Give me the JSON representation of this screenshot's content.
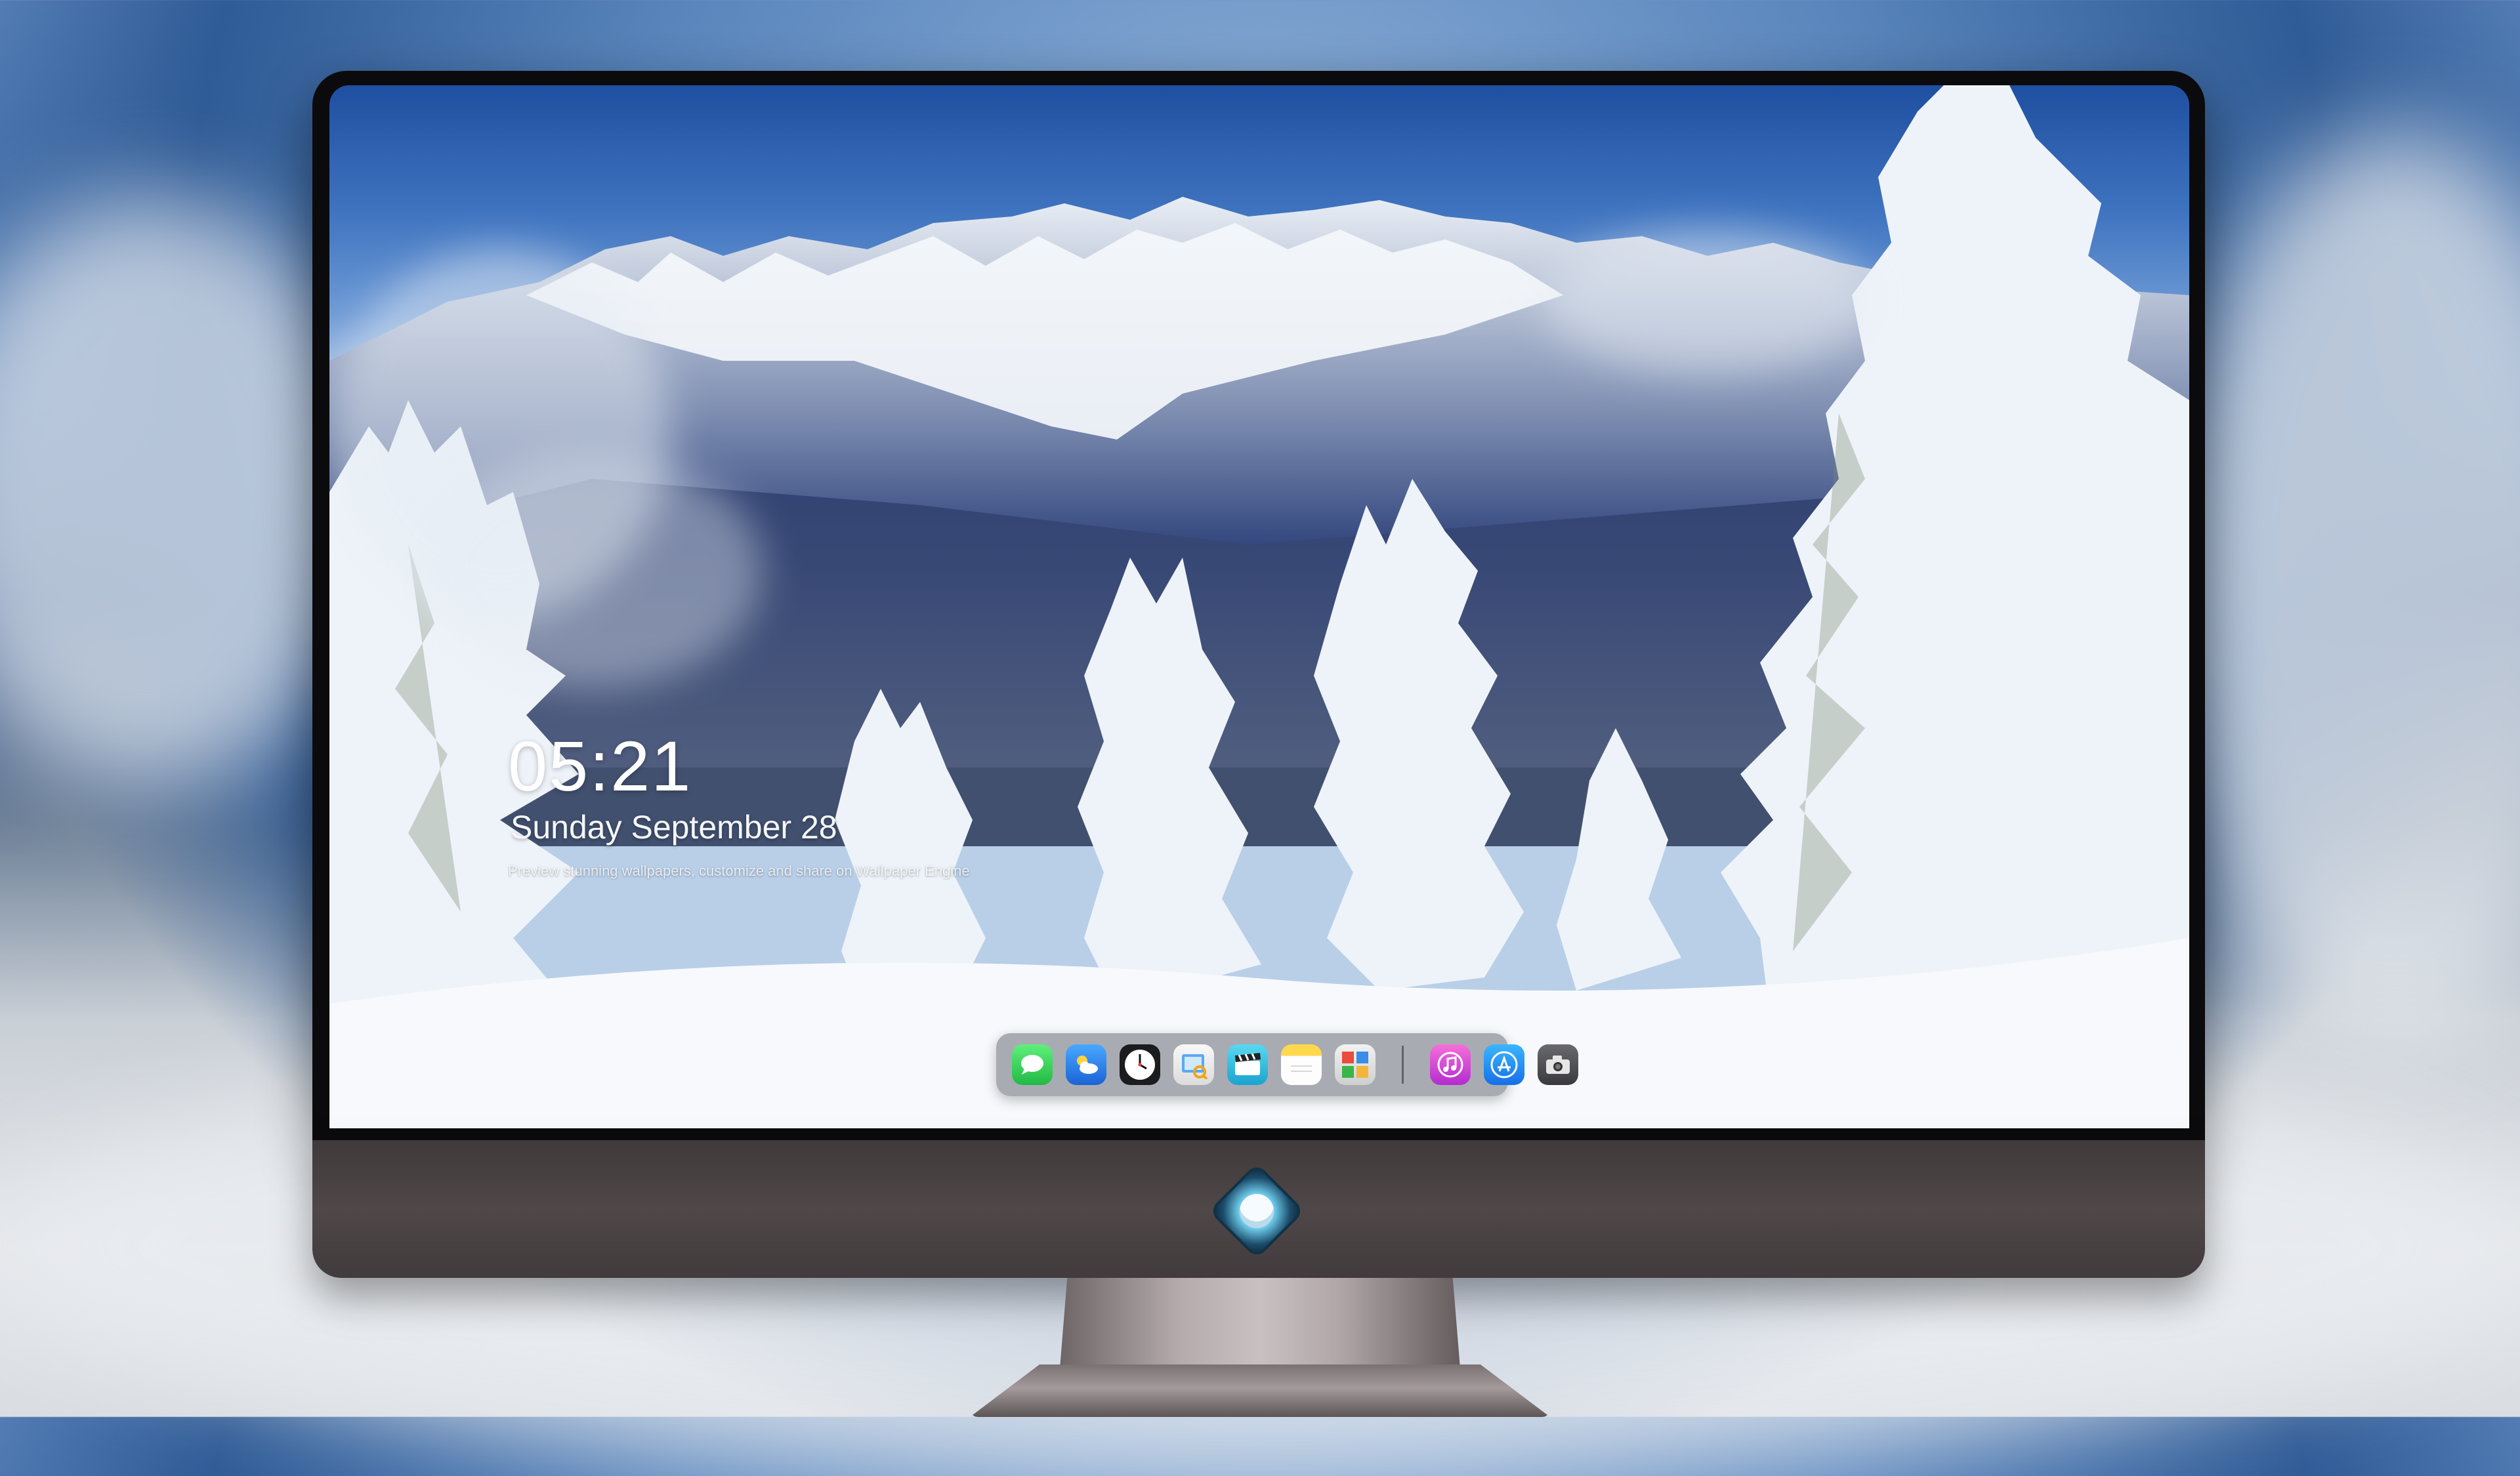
{
  "lockscreen": {
    "time": "05:21",
    "date": "Sunday September 28",
    "caption": "Preview stunning wallpapers, customize and share on Wallpaper Engine"
  },
  "dock": {
    "apps": [
      {
        "name": "messages-icon",
        "color": "#34c759"
      },
      {
        "name": "weather-icon",
        "color": "#2f8cf0"
      },
      {
        "name": "clock-icon",
        "color": "#1c1c1e"
      },
      {
        "name": "preview-icon",
        "color": "#f2c230"
      },
      {
        "name": "claquette-icon",
        "color": "#2bc0e4"
      },
      {
        "name": "notes-icon",
        "color": "#f7d54a"
      },
      {
        "name": "photo-booth-icon",
        "color": "#e8e8e8"
      },
      {
        "name": "music-icon",
        "color": "#e246c8"
      },
      {
        "name": "app-store-icon",
        "color": "#1c8ff5"
      },
      {
        "name": "camera-icon",
        "color": "#4a4a4e"
      }
    ]
  },
  "colors": {
    "sky_top": "#1f4fa0",
    "snow": "#f8fafd",
    "monitor_chin": "#4a4344",
    "bezel": "#0b0b0d"
  }
}
